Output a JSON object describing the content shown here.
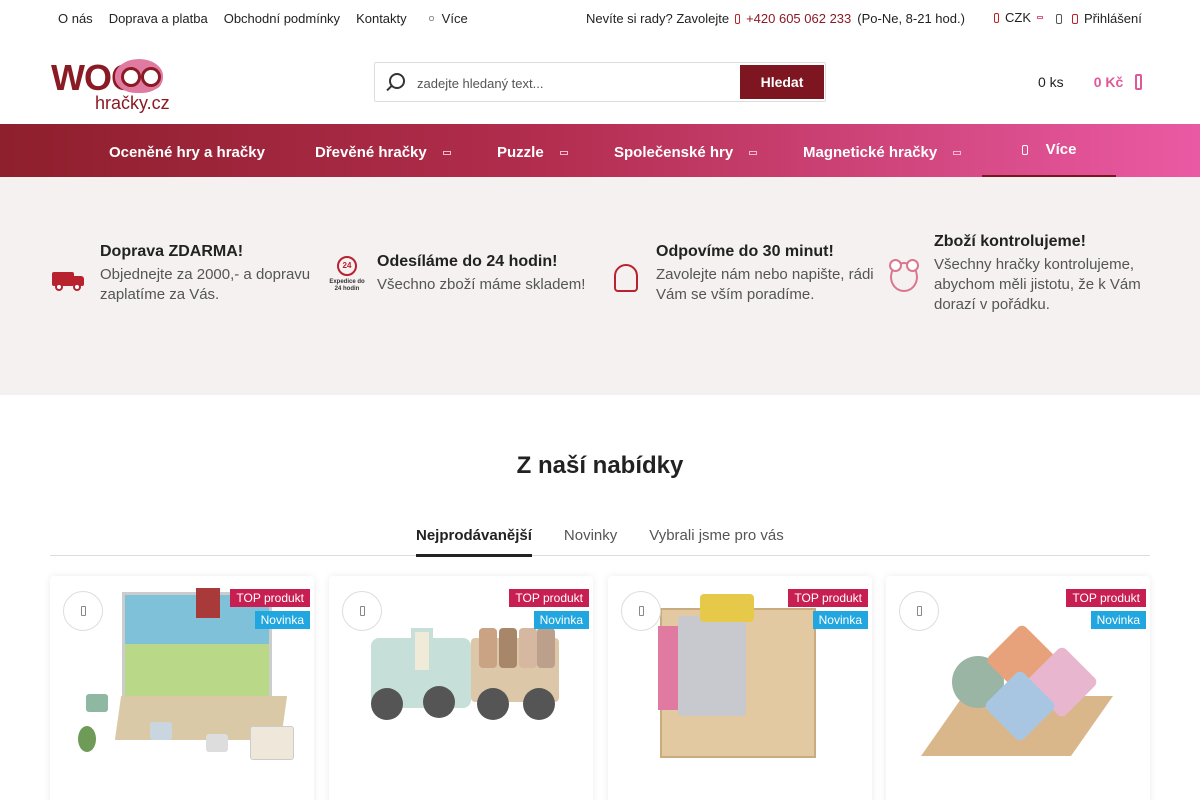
{
  "topbar": {
    "links": [
      "O nás",
      "Doprava a platba",
      "Obchodní podmínky",
      "Kontakty"
    ],
    "more_label": "Více",
    "help_text": "Nevíte si rady? Zavolejte",
    "phone": "+420 605 062 233",
    "hours": "(Po-Ne, 8-21 hod.)",
    "currency": "CZK",
    "login_label": "Přihlášení"
  },
  "logo": {
    "wood": "WOOD",
    "sub": "hračky.cz"
  },
  "search": {
    "placeholder": "zadejte hledaný text...",
    "button_label": "Hledat"
  },
  "cart": {
    "quantity": "0 ks",
    "price": "0 Kč"
  },
  "nav": {
    "items": [
      {
        "label": "Oceněné hry a hračky",
        "dropdown": false
      },
      {
        "label": "Dřevěné hračky",
        "dropdown": true
      },
      {
        "label": "Puzzle",
        "dropdown": true
      },
      {
        "label": "Společenské hry",
        "dropdown": true
      },
      {
        "label": "Magnetické hračky",
        "dropdown": true
      }
    ],
    "more_label": "Více"
  },
  "benefits": [
    {
      "icon": "truck-icon",
      "title": "Doprava ZDARMA!",
      "text": "Objednejte za 2000,- a dopravu zaplatíme za Vás."
    },
    {
      "icon": "expedition-24h-icon",
      "icon_text": "24",
      "icon_caption": "Expedice do 24 hodin",
      "title": "Odesíláme do 24 hodin!",
      "text": "Všechno zboží máme skladem!"
    },
    {
      "icon": "headset-icon",
      "title": "Odpovíme do 30 minut!",
      "text": "Zavolejte nám nebo napište, rádi Vám se vším poradíme."
    },
    {
      "icon": "teddy-bear-icon",
      "title": "Zboží kontrolujeme!",
      "text": "Všechny hračky kontrolujeme, abychom měli jistotu, že k Vám dorazí v pořádku."
    }
  ],
  "offer": {
    "title": "Z naší nabídky",
    "tabs": [
      "Nejprodávanější",
      "Novinky",
      "Vybrali jsme pro vás"
    ],
    "active_tab": 0
  },
  "products": [
    {
      "flags": [
        "TOP produkt",
        "Novinka"
      ],
      "image": "farm-magnetic-puzzle-box"
    },
    {
      "flags": [
        "TOP produkt",
        "Novinka"
      ],
      "image": "wooden-tractor-with-trailer"
    },
    {
      "flags": [
        "TOP produkt",
        "Novinka"
      ],
      "image": "wooden-activity-lock-cube"
    },
    {
      "flags": [
        "TOP produkt",
        "Novinka"
      ],
      "image": "wooden-shape-stacker"
    }
  ],
  "colors": {
    "brand": "#8a1a24",
    "accent_pink": "#e0579b",
    "flag_top": "#c81f52",
    "flag_new": "#22a6e0"
  }
}
